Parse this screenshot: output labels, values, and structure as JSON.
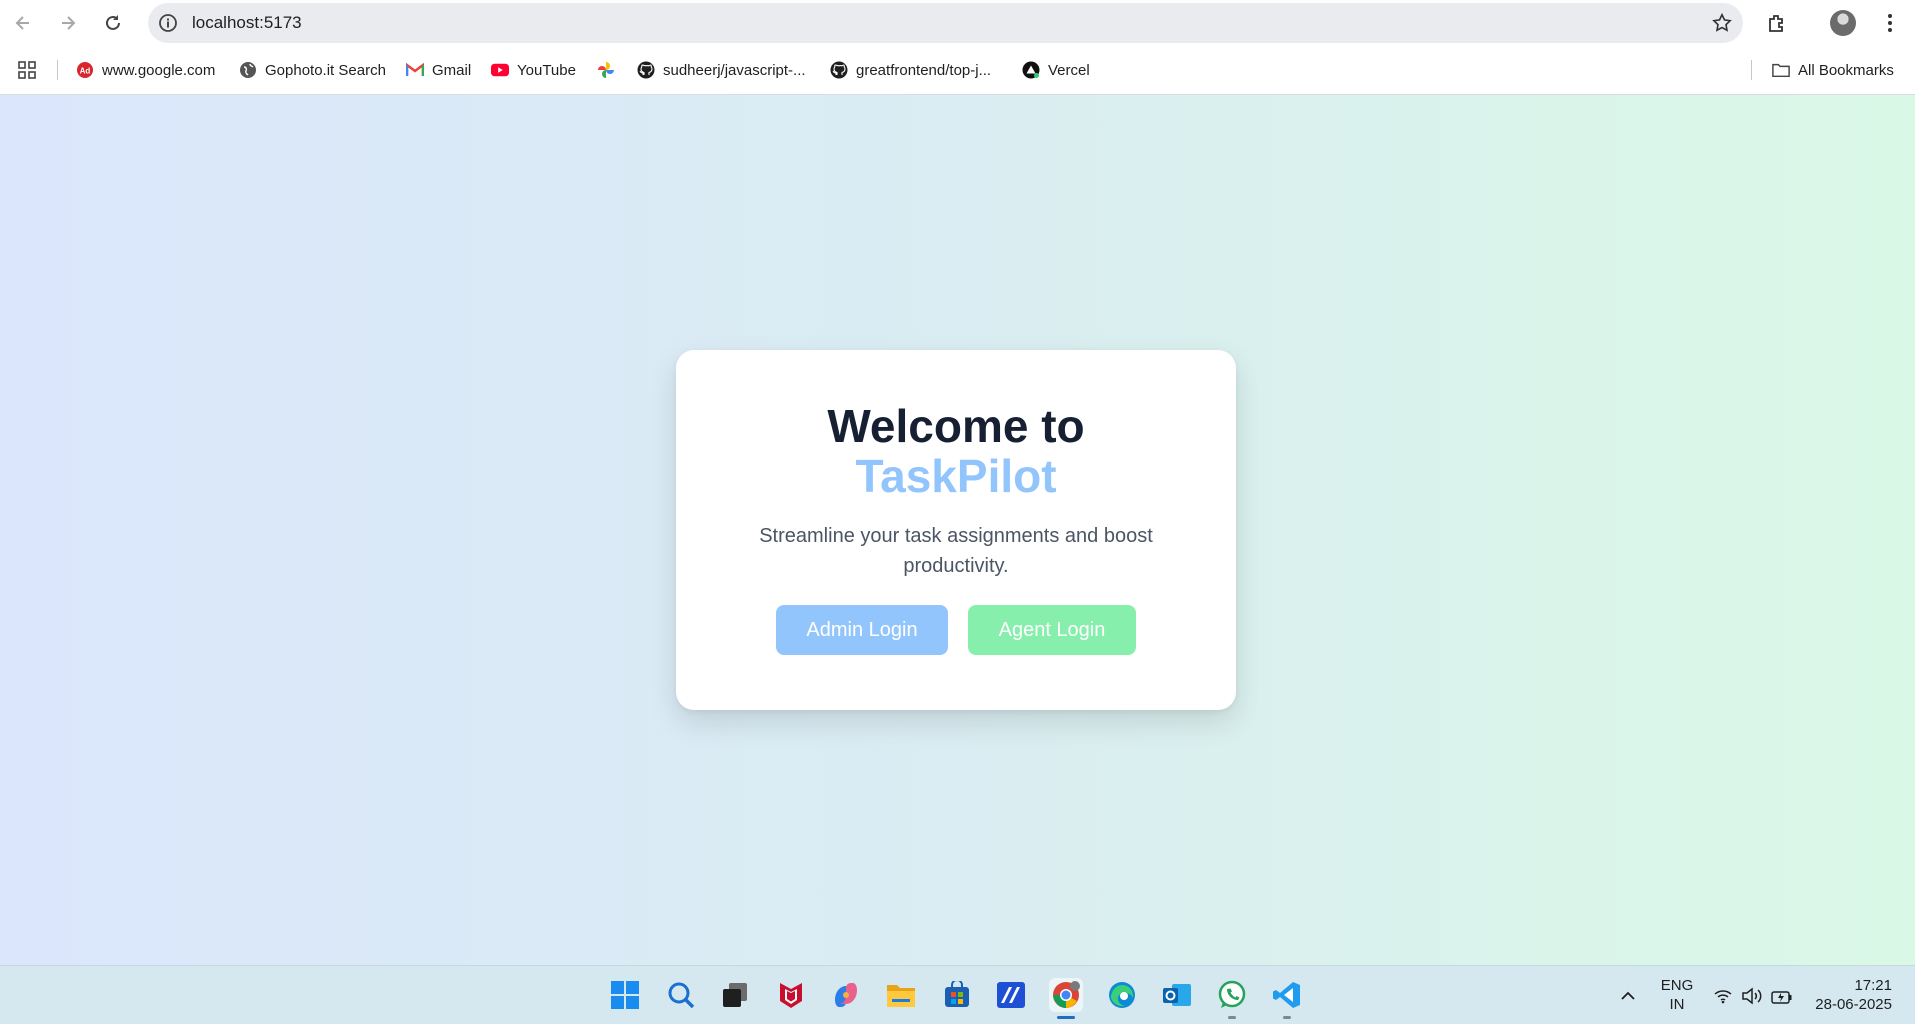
{
  "browser": {
    "url": "localhost:5173",
    "bookmarks": [
      {
        "label": "www.google.com",
        "icon": "mcafee-icon"
      },
      {
        "label": "Gophoto.it Search",
        "icon": "globe-icon"
      },
      {
        "label": "Gmail",
        "icon": "gmail-icon"
      },
      {
        "label": "YouTube",
        "icon": "youtube-icon"
      },
      {
        "label": "",
        "icon": "pinwheel-icon"
      },
      {
        "label": "sudheerj/javascript-...",
        "icon": "github-icon"
      },
      {
        "label": "greatfrontend/top-j...",
        "icon": "github-icon"
      },
      {
        "label": "Vercel",
        "icon": "vercel-icon"
      }
    ],
    "all_bookmarks_label": "All Bookmarks"
  },
  "card": {
    "title_line1": "Welcome to",
    "title_line2": "TaskPilot",
    "subtitle": "Streamline your task assignments and boost productivity.",
    "admin_button": "Admin Login",
    "agent_button": "Agent Login"
  },
  "colors": {
    "brand_accent": "#93c5fd",
    "agent_accent": "#86efac",
    "title_dark": "#172033"
  },
  "taskbar": {
    "apps": [
      "windows-start-icon",
      "search-icon",
      "task-view-icon",
      "mcafee-icon",
      "copilot-icon",
      "file-explorer-icon",
      "store-icon",
      "editor-icon",
      "chrome-icon",
      "edge-icon",
      "outlook-icon",
      "whatsapp-icon",
      "vscode-icon"
    ],
    "language_line1": "ENG",
    "language_line2": "IN",
    "time": "17:21",
    "date": "28-06-2025"
  }
}
